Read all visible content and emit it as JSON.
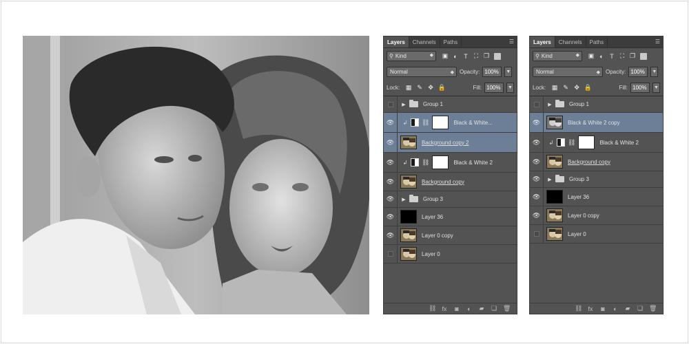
{
  "photo": {
    "alt_subject": "couple-portrait"
  },
  "colors": {
    "panel_bg": "#535353",
    "selected_row": "#6c7f97",
    "tab_bar": "#3c3c3c"
  },
  "left_panel": {
    "tabs": [
      "Layers",
      "Channels",
      "Paths"
    ],
    "filter_kind": "Kind",
    "blend_mode": "Normal",
    "opacity_label": "Opacity:",
    "opacity_value": "100%",
    "lock_label": "Lock:",
    "fill_label": "Fill:",
    "fill_value": "100%",
    "layers": [
      {
        "name": "Group 1",
        "kind": "group",
        "visible": false
      },
      {
        "name": "Black & White...",
        "kind": "adjustment",
        "visible": true,
        "selected": true
      },
      {
        "name": "Background copy 2",
        "kind": "image",
        "visible": true,
        "selected": true
      },
      {
        "name": "Black & White 2",
        "kind": "adjustment",
        "visible": true
      },
      {
        "name": "Background copy",
        "kind": "image",
        "visible": true
      },
      {
        "name": "Group 3",
        "kind": "group",
        "visible": true
      },
      {
        "name": "Layer 36",
        "kind": "black",
        "visible": true
      },
      {
        "name": "Layer 0 copy",
        "kind": "image",
        "visible": true
      },
      {
        "name": "Layer 0",
        "kind": "image",
        "visible": false
      }
    ]
  },
  "right_panel": {
    "tabs": [
      "Layers",
      "Channels",
      "Paths"
    ],
    "filter_kind": "Kind",
    "blend_mode": "Normal",
    "opacity_label": "Opacity:",
    "opacity_value": "100%",
    "lock_label": "Lock:",
    "fill_label": "Fill:",
    "fill_value": "100%",
    "layers": [
      {
        "name": "Group 1",
        "kind": "group",
        "visible": false
      },
      {
        "name": "Black & White 2 copy",
        "kind": "image-bw",
        "visible": true,
        "selected": true
      },
      {
        "name": "Black & White 2",
        "kind": "adjustment",
        "visible": true
      },
      {
        "name": "Background copy",
        "kind": "image",
        "visible": true
      },
      {
        "name": "Group 3",
        "kind": "group",
        "visible": true
      },
      {
        "name": "Layer 36",
        "kind": "black",
        "visible": true
      },
      {
        "name": "Layer 0 copy",
        "kind": "image",
        "visible": true
      },
      {
        "name": "Layer 0",
        "kind": "image",
        "visible": false
      }
    ]
  },
  "icons": {
    "eye": "eye-icon",
    "folder": "folder-icon",
    "link": "link-layers-icon",
    "fx": "fx-icon",
    "mask": "add-mask-icon",
    "adjust": "adjustment-icon",
    "new_group": "new-group-icon",
    "new_layer": "new-layer-icon",
    "trash": "trash-icon"
  }
}
